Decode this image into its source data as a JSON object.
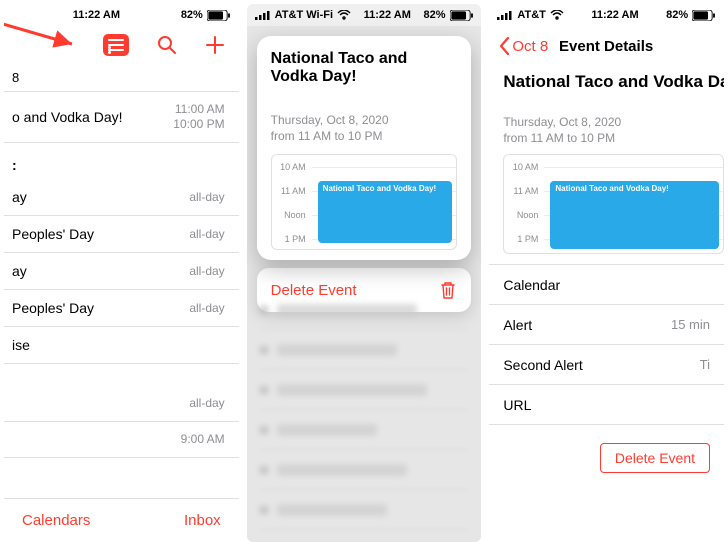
{
  "status": {
    "time": "11:22 AM",
    "battery_pct": "82%",
    "carrier": "AT&T Wi-Fi",
    "carrier_short": "AT&T"
  },
  "colors": {
    "accent": "#ff3b30",
    "event_block": "#29a9e8",
    "secondary_text": "#8e8e93"
  },
  "panel1": {
    "date_header": "8",
    "events": [
      {
        "title": "o and Vodka Day!",
        "time1": "11:00 AM",
        "time2": "10:00 PM"
      }
    ],
    "section2_header": ":",
    "section2_rows": [
      {
        "title": "ay",
        "time": "all-day"
      },
      {
        "title": "Peoples' Day",
        "time": "all-day"
      },
      {
        "title": "ay",
        "time": "all-day"
      },
      {
        "title": "Peoples' Day",
        "time": "all-day"
      },
      {
        "title": "ise",
        "time": ""
      }
    ],
    "section3_rows": [
      {
        "title": "",
        "time": "all-day"
      },
      {
        "title": "",
        "time": "9:00 AM"
      }
    ],
    "bottom": {
      "calendars": "Calendars",
      "inbox": "Inbox"
    }
  },
  "panel2": {
    "event_title": "National Taco and Vodka Day!",
    "meta_line1": "Thursday, Oct 8, 2020",
    "meta_line2": "from 11 AM to 10 PM",
    "timeline": {
      "labels": [
        "10 AM",
        "11 AM",
        "Noon",
        "1 PM"
      ],
      "event_label": "National Taco and Vodka Day!"
    },
    "delete_label": "Delete Event"
  },
  "panel3": {
    "back_label": "Oct 8",
    "nav_title": "Event Details",
    "event_title": "National Taco and Vodka Day!",
    "meta_line1": "Thursday, Oct 8, 2020",
    "meta_line2": "from 11 AM to 10 PM",
    "timeline": {
      "labels": [
        "10 AM",
        "11 AM",
        "Noon",
        "1 PM"
      ],
      "event_label": "National Taco and Vodka Day!"
    },
    "cells": {
      "calendar_label": "Calendar",
      "alert_label": "Alert",
      "alert_value": "15 min",
      "second_alert_label": "Second Alert",
      "second_alert_value": "Ti",
      "url_label": "URL"
    },
    "delete_label": "Delete Event"
  }
}
